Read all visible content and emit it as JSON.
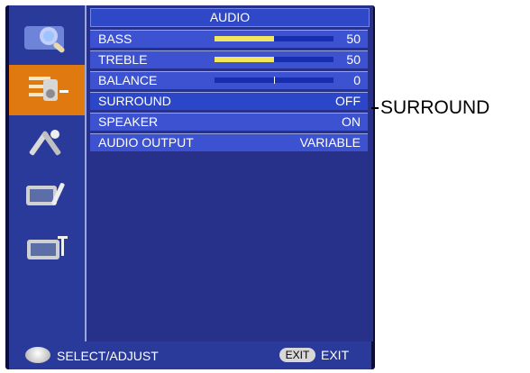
{
  "menu": {
    "title": "AUDIO",
    "items": [
      {
        "label": "BASS",
        "value": "50",
        "bar": {
          "type": "level",
          "level": 0.5
        }
      },
      {
        "label": "TREBLE",
        "value": "50",
        "bar": {
          "type": "level",
          "level": 0.5
        }
      },
      {
        "label": "BALANCE",
        "value": "0",
        "bar": {
          "type": "balance",
          "level": 0.0
        }
      },
      {
        "label": "SURROUND",
        "value": "OFF"
      },
      {
        "label": "SPEAKER",
        "value": "ON"
      },
      {
        "label": "AUDIO OUTPUT",
        "value": "VARIABLE"
      }
    ],
    "selected_index": 3
  },
  "sidebar": {
    "icons": [
      {
        "name": "picture-search-icon"
      },
      {
        "name": "audio-settings-icon",
        "active": true
      },
      {
        "name": "tools-icon"
      },
      {
        "name": "tv-tools-icon"
      },
      {
        "name": "tv-antenna-icon"
      }
    ]
  },
  "footer": {
    "select_adjust": "SELECT/ADJUST",
    "exit_button": "EXIT",
    "exit_label": "EXIT"
  },
  "callout": {
    "label": "SURROUND"
  },
  "colors": {
    "panel": "#27318a",
    "row": "#3c52d0",
    "active_icon_bg": "#e07a10",
    "bar_fill": "#f2e65a"
  }
}
